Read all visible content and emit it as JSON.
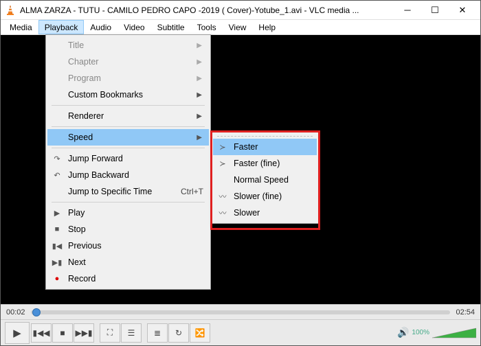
{
  "titlebar": {
    "title": "ALMA ZARZA - TUTU - CAMILO PEDRO CAPO -2019 ( Cover)-Yotube_1.avi - VLC media ..."
  },
  "menubar": {
    "items": [
      "Media",
      "Playback",
      "Audio",
      "Video",
      "Subtitle",
      "Tools",
      "View",
      "Help"
    ],
    "active": "Playback"
  },
  "dropdown": {
    "title": "Title",
    "chapter": "Chapter",
    "program": "Program",
    "custom_bookmarks": "Custom Bookmarks",
    "renderer": "Renderer",
    "speed": "Speed",
    "jump_forward": "Jump Forward",
    "jump_backward": "Jump Backward",
    "jump_specific": "Jump to Specific Time",
    "jump_specific_shortcut": "Ctrl+T",
    "play": "Play",
    "stop": "Stop",
    "previous": "Previous",
    "next": "Next",
    "record": "Record"
  },
  "submenu": {
    "faster": "Faster",
    "faster_fine": "Faster (fine)",
    "normal": "Normal Speed",
    "slower_fine": "Slower (fine)",
    "slower": "Slower"
  },
  "time": {
    "current": "00:02",
    "total": "02:54"
  },
  "volume": {
    "percent": "100%"
  }
}
